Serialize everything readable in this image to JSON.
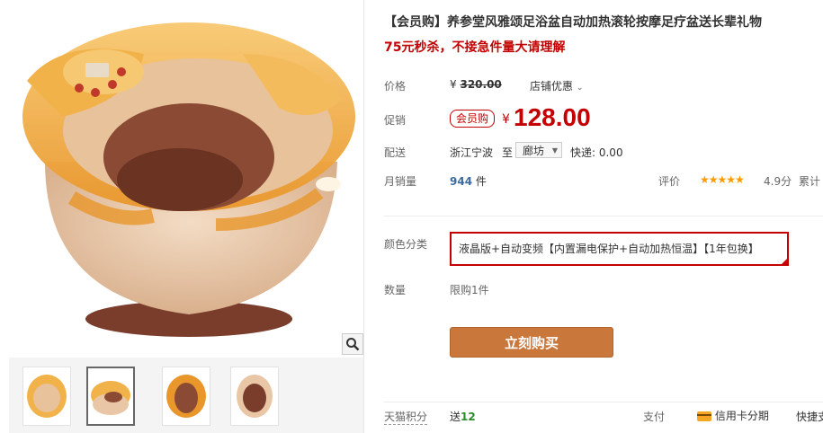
{
  "product": {
    "title": "【会员购】养参堂风雅颂足浴盆自动加热滚轮按摩足疗盆送长辈礼物",
    "subtitle": "75元秒杀，不接急件量大请理解"
  },
  "price": {
    "label": "价格",
    "original_yen": "¥",
    "original": "320.00",
    "shop_discount": "店铺优惠",
    "promo_label": "促销",
    "badge": "会员购",
    "yen": "¥",
    "promo_price": "128.00"
  },
  "shipping": {
    "label": "配送",
    "from": "浙江宁波",
    "to_word": "至",
    "destination": "廊坊",
    "method": "快递: 0.00"
  },
  "sales": {
    "label": "月销量",
    "count": "944",
    "unit": "件",
    "rating_label": "评价",
    "stars": "★★★★★",
    "score": "4.9分",
    "cumulative": "累计"
  },
  "options": {
    "color_label": "颜色分类",
    "selected_variant": "液晶版+自动变频【内置漏电保护+自动加热恒温】【1年包换】",
    "quantity_label": "数量",
    "limit_text": "限购1件"
  },
  "actions": {
    "buy_now": "立刻购买"
  },
  "footer": {
    "tmall_points_label": "天猫积分",
    "send_word": "送",
    "points": "12",
    "payment_label": "支付",
    "credit": "信用卡分期",
    "express_pay": "快捷支"
  },
  "colors": {
    "accent_red": "#c40000",
    "buy_button": "#c9773a",
    "tub_orange": "#f0a530",
    "tub_body": "#e9c7a6"
  }
}
